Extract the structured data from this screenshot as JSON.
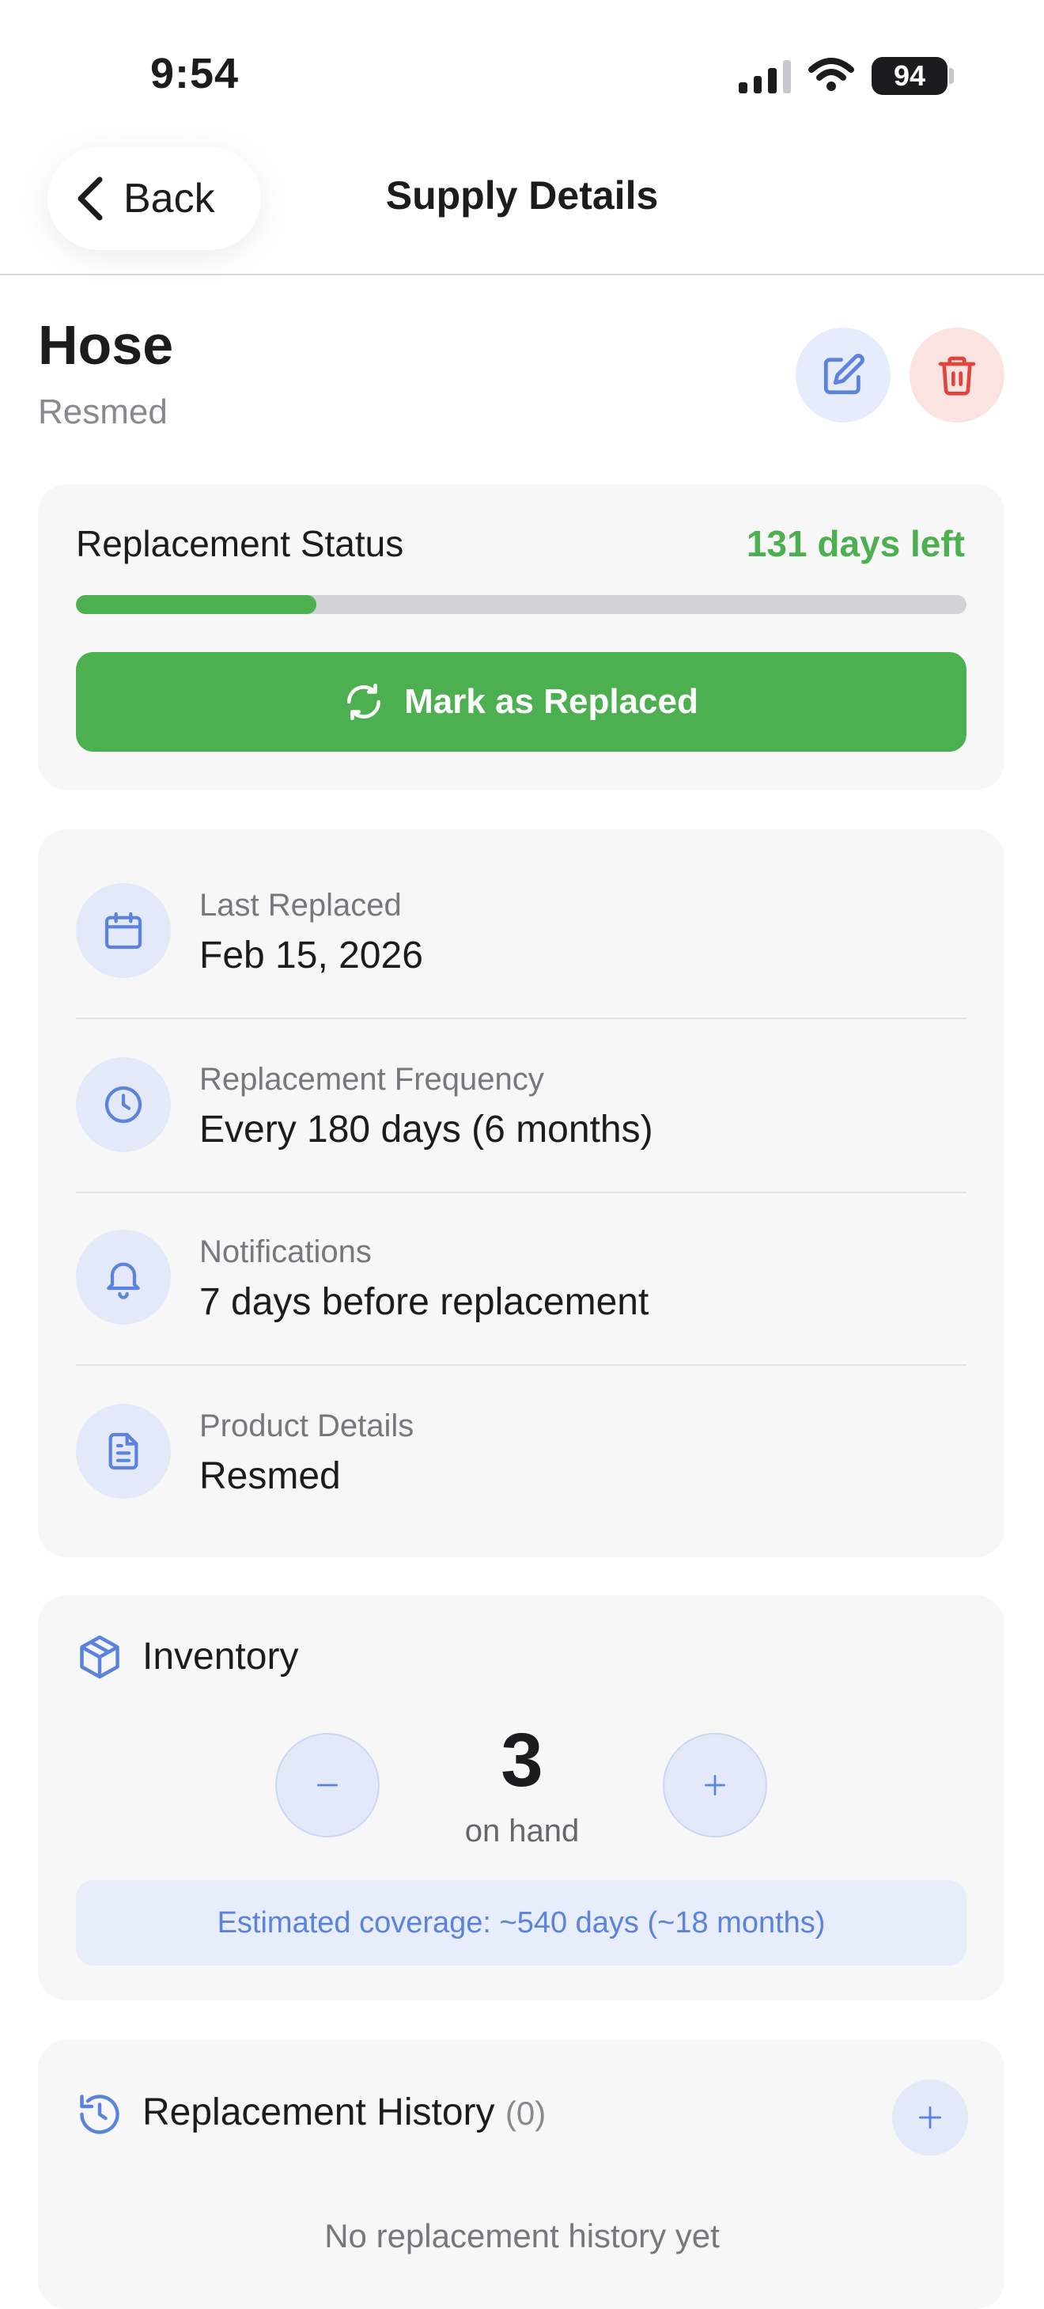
{
  "status_bar": {
    "time": "9:54",
    "battery": "94"
  },
  "nav": {
    "back_label": "Back",
    "title": "Supply Details"
  },
  "item": {
    "name": "Hose",
    "brand": "Resmed"
  },
  "replacement_status": {
    "label": "Replacement Status",
    "days_left": "131 days left",
    "progress_fraction": 0.27,
    "button_label": "Mark as Replaced"
  },
  "details": [
    {
      "icon": "calendar-icon",
      "label": "Last Replaced",
      "value": "Feb 15, 2026"
    },
    {
      "icon": "clock-icon",
      "label": "Replacement Frequency",
      "value": "Every 180 days (6 months)"
    },
    {
      "icon": "bell-icon",
      "label": "Notifications",
      "value": "7 days before replacement"
    },
    {
      "icon": "document-icon",
      "label": "Product Details",
      "value": "Resmed"
    }
  ],
  "inventory": {
    "title": "Inventory",
    "count": "3",
    "unit": "on hand",
    "coverage": "Estimated coverage: ~540 days (~18 months)"
  },
  "history": {
    "title": "Replacement History",
    "count": "(0)",
    "empty_text": "No replacement history yet"
  },
  "colors": {
    "accent_green": "#4caf50",
    "accent_blue": "#5b83de",
    "danger_red": "#e0443a"
  }
}
